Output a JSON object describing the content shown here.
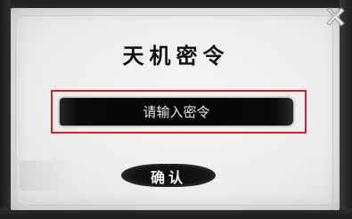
{
  "dialog": {
    "title": "天机密令",
    "input": {
      "placeholder": "请输入密令",
      "value": ""
    },
    "confirm_label": "确认",
    "close_icon": "close-icon"
  },
  "colors": {
    "highlight": "#d32424",
    "ink": "#050505",
    "paper": "#efefef"
  }
}
